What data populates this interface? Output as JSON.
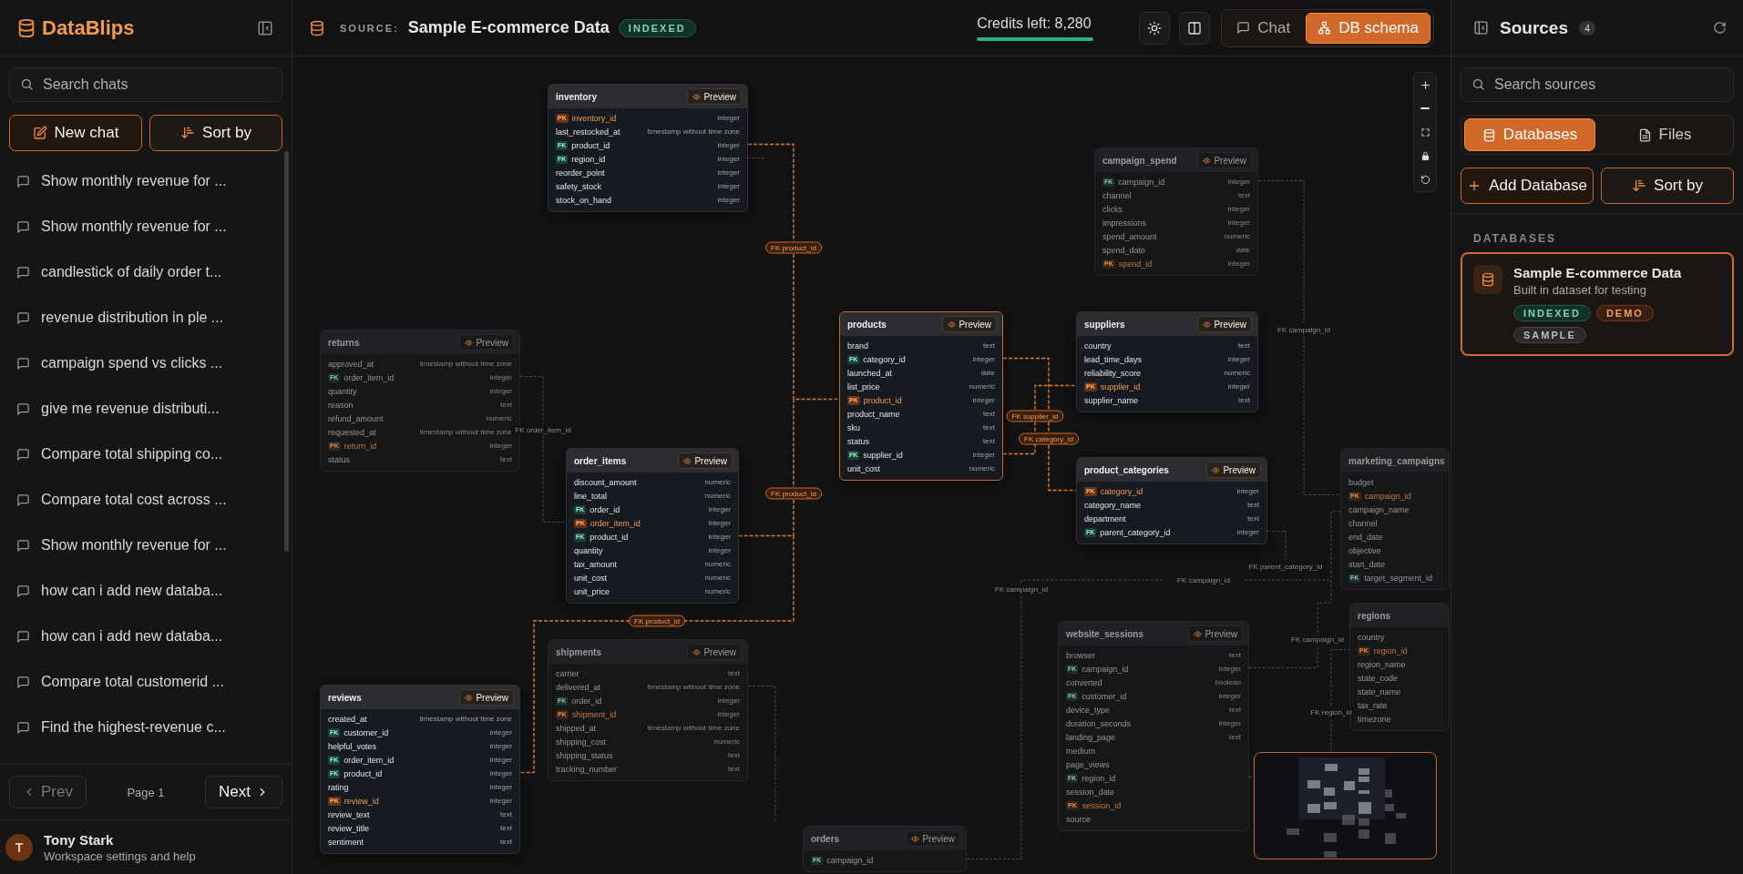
{
  "app": {
    "name": "DataBlips"
  },
  "sidebar": {
    "search": {
      "placeholder": "Search chats"
    },
    "buttons": [
      {
        "label": "New chat",
        "kind": "new"
      },
      {
        "label": "Sort by",
        "kind": "sort"
      }
    ],
    "chats": [
      {
        "title": "Show monthly revenue for ..."
      },
      {
        "title": "Show monthly revenue for ..."
      },
      {
        "title": "candlestick of daily order t..."
      },
      {
        "title": "revenue distribution in ple ..."
      },
      {
        "title": "campaign spend vs clicks ..."
      },
      {
        "title": "give me revenue distributi..."
      },
      {
        "title": "Compare total shipping co..."
      },
      {
        "title": "Compare total cost across ..."
      },
      {
        "title": "Show monthly revenue for ..."
      },
      {
        "title": "how can i add new databa..."
      },
      {
        "title": "how can i add new databa..."
      },
      {
        "title": "Compare total customerid ..."
      },
      {
        "title": "Find the highest-revenue c..."
      }
    ],
    "pagination": {
      "prev": {
        "label": "Prev",
        "disabled": true
      },
      "page": "Page 1",
      "next": {
        "label": "Next",
        "disabled": false
      }
    },
    "user": {
      "initial": "T",
      "name": "Tony Stark",
      "subtitle": "Workspace settings and help"
    }
  },
  "header": {
    "source_label": "SOURCE:",
    "source_name": "Sample E-commerce Data",
    "status": "INDEXED",
    "credits": {
      "text": "Credits left: 8,280",
      "level": 1
    },
    "view_tabs": [
      {
        "label": "Chat",
        "kind": "chat",
        "selected": false
      },
      {
        "label": "DB schema",
        "kind": "schema",
        "selected": true
      }
    ]
  },
  "schema": {
    "tables": [
      {
        "name": "inventory",
        "dimmed": false,
        "selected": false,
        "preview": "Preview",
        "columns": [
          {
            "name": "inventory_id",
            "key": {
              "label": "PK",
              "kind": "primary"
            },
            "type": "integer"
          },
          {
            "name": "last_restocked_at",
            "type": "timestamp without time zone"
          },
          {
            "name": "product_id",
            "key": {
              "label": "FK",
              "kind": "foreign"
            },
            "type": "integer"
          },
          {
            "name": "region_id",
            "key": {
              "label": "FK",
              "kind": "foreign"
            },
            "type": "integer"
          },
          {
            "name": "reorder_point",
            "type": "integer"
          },
          {
            "name": "safety_stock",
            "type": "integer"
          },
          {
            "name": "stock_on_hand",
            "type": "integer"
          }
        ]
      },
      {
        "name": "campaign_spend",
        "dimmed": true,
        "selected": false,
        "preview": "Preview",
        "columns": [
          {
            "name": "campaign_id",
            "key": {
              "label": "FK",
              "kind": "foreign"
            },
            "type": "integer"
          },
          {
            "name": "channel",
            "type": "text"
          },
          {
            "name": "clicks",
            "type": "integer"
          },
          {
            "name": "impressions",
            "type": "integer"
          },
          {
            "name": "spend_amount",
            "type": "numeric"
          },
          {
            "name": "spend_date",
            "type": "date"
          },
          {
            "name": "spend_id",
            "key": {
              "label": "PK",
              "kind": "primary"
            },
            "type": "integer"
          }
        ]
      },
      {
        "name": "returns",
        "dimmed": true,
        "selected": false,
        "preview": "Preview",
        "columns": [
          {
            "name": "approved_at",
            "type": "timestamp without time zone"
          },
          {
            "name": "order_item_id",
            "key": {
              "label": "FK",
              "kind": "foreign"
            },
            "type": "integer"
          },
          {
            "name": "quantity",
            "type": "integer"
          },
          {
            "name": "reason",
            "type": "text"
          },
          {
            "name": "refund_amount",
            "type": "numeric"
          },
          {
            "name": "requested_at",
            "type": "timestamp without time zone"
          },
          {
            "name": "return_id",
            "key": {
              "label": "PK",
              "kind": "primary"
            },
            "type": "integer"
          },
          {
            "name": "status",
            "type": "text"
          }
        ]
      },
      {
        "name": "products",
        "dimmed": false,
        "selected": true,
        "preview": "Preview",
        "columns": [
          {
            "name": "brand",
            "type": "text"
          },
          {
            "name": "category_id",
            "key": {
              "label": "FK",
              "kind": "foreign"
            },
            "type": "integer"
          },
          {
            "name": "launched_at",
            "type": "date"
          },
          {
            "name": "list_price",
            "type": "numeric"
          },
          {
            "name": "product_id",
            "key": {
              "label": "PK",
              "kind": "primary"
            },
            "type": "integer"
          },
          {
            "name": "product_name",
            "type": "text"
          },
          {
            "name": "sku",
            "type": "text"
          },
          {
            "name": "status",
            "type": "text"
          },
          {
            "name": "supplier_id",
            "key": {
              "label": "FK",
              "kind": "foreign"
            },
            "type": "integer"
          },
          {
            "name": "unit_cost",
            "type": "numeric"
          }
        ]
      },
      {
        "name": "suppliers",
        "dimmed": false,
        "selected": false,
        "preview": "Preview",
        "columns": [
          {
            "name": "country",
            "type": "text"
          },
          {
            "name": "lead_time_days",
            "type": "integer"
          },
          {
            "name": "reliability_score",
            "type": "numeric"
          },
          {
            "name": "supplier_id",
            "key": {
              "label": "PK",
              "kind": "primary"
            },
            "type": "integer"
          },
          {
            "name": "supplier_name",
            "type": "text"
          }
        ]
      },
      {
        "name": "order_items",
        "dimmed": false,
        "selected": false,
        "preview": "Preview",
        "columns": [
          {
            "name": "discount_amount",
            "type": "numeric"
          },
          {
            "name": "line_total",
            "type": "numeric"
          },
          {
            "name": "order_id",
            "key": {
              "label": "FK",
              "kind": "foreign"
            },
            "type": "integer"
          },
          {
            "name": "order_item_id",
            "key": {
              "label": "PK",
              "kind": "primary"
            },
            "type": "integer"
          },
          {
            "name": "product_id",
            "key": {
              "label": "FK",
              "kind": "foreign"
            },
            "type": "integer"
          },
          {
            "name": "quantity",
            "type": "integer"
          },
          {
            "name": "tax_amount",
            "type": "numeric"
          },
          {
            "name": "unit_cost",
            "type": "numeric"
          },
          {
            "name": "unit_price",
            "type": "numeric"
          }
        ]
      },
      {
        "name": "product_categories",
        "dimmed": false,
        "selected": false,
        "preview": "Preview",
        "columns": [
          {
            "name": "category_id",
            "key": {
              "label": "PK",
              "kind": "primary"
            },
            "type": "integer"
          },
          {
            "name": "category_name",
            "type": "text"
          },
          {
            "name": "department",
            "type": "text"
          },
          {
            "name": "parent_category_id",
            "key": {
              "label": "FK",
              "kind": "foreign"
            },
            "type": "integer"
          }
        ]
      },
      {
        "name": "marketing_campaigns",
        "dimmed": true,
        "selected": false,
        "columns": [
          {
            "name": "budget"
          },
          {
            "name": "campaign_id",
            "key": {
              "label": "PK",
              "kind": "primary"
            }
          },
          {
            "name": "campaign_name"
          },
          {
            "name": "channel"
          },
          {
            "name": "end_date"
          },
          {
            "name": "objective"
          },
          {
            "name": "start_date"
          },
          {
            "name": "target_segment_id",
            "key": {
              "label": "FK",
              "kind": "foreign"
            }
          }
        ]
      },
      {
        "name": "reviews",
        "dimmed": false,
        "selected": false,
        "preview": "Preview",
        "columns": [
          {
            "name": "created_at",
            "type": "timestamp without time zone"
          },
          {
            "name": "customer_id",
            "key": {
              "label": "FK",
              "kind": "foreign"
            },
            "type": "integer"
          },
          {
            "name": "helpful_votes",
            "type": "integer"
          },
          {
            "name": "order_item_id",
            "key": {
              "label": "FK",
              "kind": "foreign"
            },
            "type": "integer"
          },
          {
            "name": "product_id",
            "key": {
              "label": "FK",
              "kind": "foreign"
            },
            "type": "integer"
          },
          {
            "name": "rating",
            "type": "integer"
          },
          {
            "name": "review_id",
            "key": {
              "label": "PK",
              "kind": "primary"
            },
            "type": "integer"
          },
          {
            "name": "review_text",
            "type": "text"
          },
          {
            "name": "review_title",
            "type": "text"
          },
          {
            "name": "sentiment",
            "type": "text"
          }
        ]
      },
      {
        "name": "shipments",
        "dimmed": true,
        "selected": false,
        "preview": "Preview",
        "columns": [
          {
            "name": "carrier",
            "type": "text"
          },
          {
            "name": "delivered_at",
            "type": "timestamp without time zone"
          },
          {
            "name": "order_id",
            "key": {
              "label": "FK",
              "kind": "foreign"
            },
            "type": "integer"
          },
          {
            "name": "shipment_id",
            "key": {
              "label": "PK",
              "kind": "primary"
            },
            "type": "integer"
          },
          {
            "name": "shipped_at",
            "type": "timestamp without time zone"
          },
          {
            "name": "shipping_cost",
            "type": "numeric"
          },
          {
            "name": "shipping_status",
            "type": "text"
          },
          {
            "name": "tracking_number",
            "type": "text"
          }
        ]
      },
      {
        "name": "website_sessions",
        "dimmed": true,
        "selected": false,
        "preview": "Preview",
        "columns": [
          {
            "name": "browser",
            "type": "text"
          },
          {
            "name": "campaign_id",
            "key": {
              "label": "FK",
              "kind": "foreign"
            },
            "type": "integer"
          },
          {
            "name": "converted",
            "type": "boolean"
          },
          {
            "name": "customer_id",
            "key": {
              "label": "FK",
              "kind": "foreign"
            },
            "type": "integer"
          },
          {
            "name": "device_type",
            "type": "text"
          },
          {
            "name": "duration_seconds",
            "type": "integer"
          },
          {
            "name": "landing_page",
            "type": "text"
          },
          {
            "name": "medium"
          },
          {
            "name": "page_views"
          },
          {
            "name": "region_id",
            "key": {
              "label": "FK",
              "kind": "foreign"
            }
          },
          {
            "name": "session_date"
          },
          {
            "name": "session_id",
            "key": {
              "label": "PK",
              "kind": "primary"
            }
          },
          {
            "name": "source"
          }
        ]
      },
      {
        "name": "regions",
        "dimmed": true,
        "selected": false,
        "columns": [
          {
            "name": "country"
          },
          {
            "name": "region_id",
            "key": {
              "label": "PK",
              "kind": "primary"
            }
          },
          {
            "name": "region_name"
          },
          {
            "name": "state_code"
          },
          {
            "name": "state_name"
          },
          {
            "name": "tax_rate"
          },
          {
            "name": "timezone"
          }
        ]
      },
      {
        "name": "orders",
        "dimmed": true,
        "selected": false,
        "preview": "Preview",
        "columns": [
          {
            "name": "campaign_id",
            "key": {
              "label": "FK",
              "kind": "foreign"
            }
          }
        ]
      }
    ],
    "relations": [
      {
        "label": "FK product_id",
        "highlighted": true
      },
      {
        "label": "FK supplier_id",
        "highlighted": true
      },
      {
        "label": "FK category_id",
        "highlighted": true
      },
      {
        "label": "FK product_id",
        "highlighted": true
      },
      {
        "label": "FK product_id",
        "highlighted": true
      },
      {
        "label": "FK campaign_id",
        "highlighted": false
      },
      {
        "label": "FK order_item_id",
        "highlighted": false
      },
      {
        "label": "FK parent_category_id",
        "highlighted": false
      },
      {
        "label": "FK campaign_id",
        "highlighted": false
      },
      {
        "label": "FK campaign_id",
        "highlighted": false
      },
      {
        "label": "FK campaign_id",
        "highlighted": false
      },
      {
        "label": "FK region_id",
        "highlighted": false
      }
    ]
  },
  "sources_panel": {
    "title": "Sources",
    "count": "4",
    "search": {
      "placeholder": "Search sources"
    },
    "tabs": [
      {
        "label": "Databases",
        "kind": "databases",
        "selected": true
      },
      {
        "label": "Files",
        "kind": "files",
        "selected": false
      }
    ],
    "buttons": [
      {
        "label": "Add Database",
        "kind": "add"
      },
      {
        "label": "Sort by",
        "kind": "sort"
      }
    ],
    "section": "DATABASES",
    "databases": [
      {
        "name": "Sample E-commerce Data",
        "description": "Built in dataset for testing",
        "selected": true,
        "badges": [
          {
            "label": "INDEXED",
            "kind": "indexed"
          },
          {
            "label": "DEMO",
            "kind": "demo"
          },
          {
            "label": "SAMPLE",
            "kind": "sample"
          }
        ]
      }
    ]
  }
}
